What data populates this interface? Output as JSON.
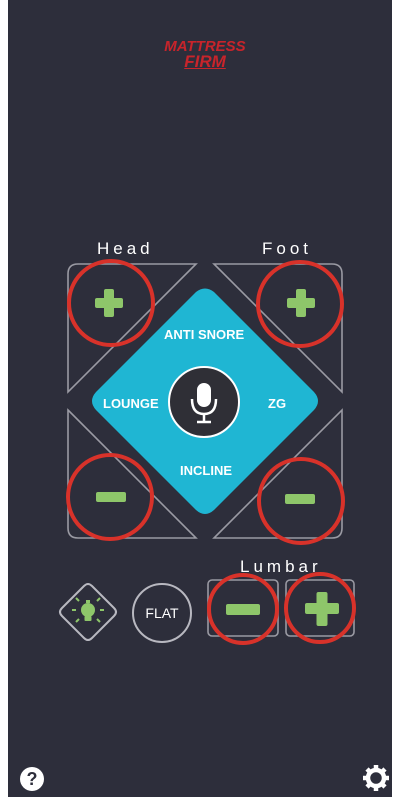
{
  "brand": {
    "line1": "MATTRESS",
    "line2": "FIRM"
  },
  "labels": {
    "head": "Head",
    "foot": "Foot",
    "lumbar": "Lumbar"
  },
  "presets": {
    "top": "ANTI SNORE",
    "left": "LOUNGE",
    "right": "ZG",
    "bottom": "INCLINE"
  },
  "buttons": {
    "flat": "FLAT"
  },
  "icons": {
    "mic": "microphone-icon",
    "light": "light-bulb-icon",
    "help": "question-icon",
    "settings": "gear-icon",
    "plus": "plus-icon",
    "minus": "minus-icon"
  },
  "colors": {
    "background": "#2d2e3b",
    "accent_diamond": "#1fb6d3",
    "control_green": "#8ec66a",
    "highlight_circle": "#d8322a",
    "brand_red": "#c8242b"
  },
  "help_glyph": "?"
}
